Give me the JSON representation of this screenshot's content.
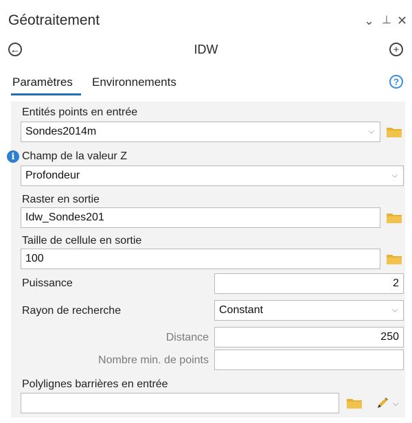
{
  "pane": {
    "title": "Géotraitement",
    "controls": {
      "dropdown": "⌄",
      "pin": "⊥",
      "close": "✕"
    },
    "back_glyph": "←",
    "add_glyph": "+",
    "tool_name": "IDW"
  },
  "tabs": [
    {
      "label": "Paramètres",
      "active": true
    },
    {
      "label": "Environnements",
      "active": false
    }
  ],
  "help_glyph": "?",
  "params": {
    "input_points": {
      "label": "Entités points en entrée",
      "value": "Sondes2014m"
    },
    "z_field": {
      "label": "Champ de la valeur Z",
      "value": "Profondeur",
      "info_glyph": "i"
    },
    "output_raster": {
      "label": "Raster en sortie",
      "value": "Idw_Sondes201"
    },
    "cell_size": {
      "label": "Taille de cellule en sortie",
      "value": "100"
    },
    "power": {
      "label": "Puissance",
      "value": "2"
    },
    "search_radius": {
      "label": "Rayon de recherche",
      "value": "Constant"
    },
    "distance": {
      "label": "Distance",
      "value": "250"
    },
    "min_points": {
      "label": "Nombre min. de points",
      "value": ""
    },
    "barriers": {
      "label": "Polylignes barrières en entrée",
      "value": ""
    }
  },
  "icons": {
    "folder_color": "#e8b230",
    "accent": "#1d6fb8",
    "info_color": "#2f7fd1"
  }
}
